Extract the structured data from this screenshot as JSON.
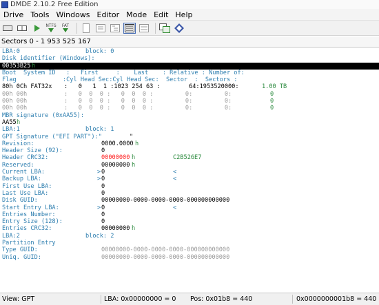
{
  "window": {
    "title": "DMDE 2.10.2 Free Edition"
  },
  "menu": [
    "Drive",
    "Tools",
    "Windows",
    "Editor",
    "Mode",
    "Edit",
    "Help"
  ],
  "toolbar": {
    "ntfs_label": "NTFS",
    "fat_label": "FAT"
  },
  "sectors_bar": "Sectors 0 - 1 953 525 167",
  "lines": {
    "l0": {
      "a": "LBA:0",
      "b": "block: 0"
    },
    "l1": {
      "a": "Disk identifier (Windows):"
    },
    "l2": {
      "a": "00353B25",
      "b": "h"
    },
    "l3": {
      "a": "Boot  System ID   :   First     :    Last    : Relative : Number of:"
    },
    "l4": {
      "a": "Flag             :Cyl Head Sec:Cyl Head Sec:  Sector  :  Sectors :"
    },
    "l5": {
      "a": "80h 0Ch FAT32x",
      "b": ":   0   1  1 :1023 254 63 :        64:1953520000:",
      "c": "1.00 TB"
    },
    "l6": {
      "a": "00h 00h",
      "b": ":   0  0  0 :   0  0  0 :         0:         0:",
      "c": "0"
    },
    "l7": {
      "a": "00h 00h",
      "b": ":   0  0  0 :   0  0  0 :         0:         0:",
      "c": "0"
    },
    "l8": {
      "a": "00h 00h",
      "b": ":   0  0  0 :   0  0  0 :         0:         0:",
      "c": "0"
    },
    "l9": {
      "a": "MBR signature (0xAA55):"
    },
    "l10": {
      "a": "AA55",
      "b": "h"
    },
    "l11": {
      "a": "LBA:1",
      "b": "block: 1"
    },
    "l12": {
      "a": "GPT Signature (\"EFI PART\"):\"",
      "b": "\""
    },
    "l13": {
      "a": "Revision:",
      "b": "0000.0000",
      "c": "h"
    },
    "l14": {
      "a": "Header Size (92):",
      "b": "0"
    },
    "l15": {
      "a": "Header CRC32:",
      "b": "00000000",
      "c": "h",
      "d": "C2B526E7"
    },
    "l16": {
      "a": "Reserved:",
      "b": "00000000",
      "c": "h"
    },
    "l17": {
      "a": "Current LBA:",
      "b": ">",
      "c": "0",
      "d": "<"
    },
    "l18": {
      "a": "Backup LBA:",
      "b": ">",
      "c": "0",
      "d": "<"
    },
    "l19": {
      "a": "First Use LBA:",
      "b": "0"
    },
    "l20": {
      "a": "Last Use LBA:",
      "b": "0"
    },
    "l21": {
      "a": "Disk GUID:",
      "b": "00000000-0000-0000-0000-000000000000"
    },
    "l22": {
      "a": "Start Entry LBA:",
      "b": ">",
      "c": "0",
      "d": "<"
    },
    "l23": {
      "a": "Entries Number:",
      "b": "0"
    },
    "l24": {
      "a": "Entry Size (128):",
      "b": "0"
    },
    "l25": {
      "a": "Entries CRC32:",
      "b": "00000000",
      "c": "h"
    },
    "l26": {
      "a": "LBA:2",
      "b": "block: 2"
    },
    "l27": {
      "a": "Partition Entry"
    },
    "l28": {
      "a": "Type GUID:",
      "b": "00000000-0000-0000-0000-000000000000"
    },
    "l29": {
      "a": "Uniq. GUID:",
      "b": "00000000-0000-0000-0000-000000000000"
    }
  },
  "status": {
    "view": "View: GPT",
    "lba": "LBA: 0x00000000 = 0",
    "pos": "Pos: 0x01b8 = 440",
    "offset": "0x0000000001b8 = 440"
  },
  "colors": {
    "label_blue": "#2f7fb0",
    "value_green": "#2b8a3e",
    "crc_red": "#ff2020",
    "inactive_grey": "#9a9a9a"
  }
}
